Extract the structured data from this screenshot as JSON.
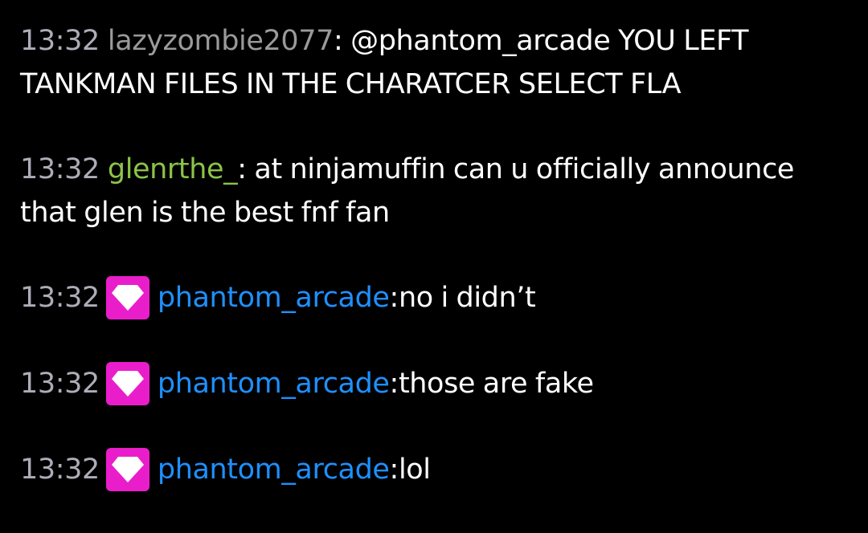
{
  "messages": [
    {
      "time": "13:32",
      "username": "lazyzombie2077",
      "separator": ": ",
      "text": "@phantom_arcade YOU LEFT TANKMAN FILES IN THE CHARATCER SELECT FLA",
      "name_color": "#9a9a9a"
    },
    {
      "time": "13:32",
      "username": "glenrthe_",
      "separator": ": ",
      "text": "at ninjamuffin can u officially announce that glen is the best fnf fan",
      "name_color": "#8bc34a"
    },
    {
      "time": "13:32",
      "badge_icon": "diamond-icon",
      "username": "phantom_arcade",
      "separator": ": ",
      "text": "no i didn’t",
      "name_color": "#1e90ff"
    },
    {
      "time": "13:32",
      "badge_icon": "diamond-icon",
      "username": "phantom_arcade",
      "separator": ": ",
      "text": "those are fake",
      "name_color": "#1e90ff"
    },
    {
      "time": "13:32",
      "badge_icon": "diamond-icon",
      "username": "phantom_arcade",
      "separator": ": ",
      "text": "lol",
      "name_color": "#1e90ff"
    }
  ],
  "colors": {
    "background": "#000000",
    "timestamp": "#adadb8",
    "badge": "#e91eca",
    "message_text": "#ffffff"
  }
}
